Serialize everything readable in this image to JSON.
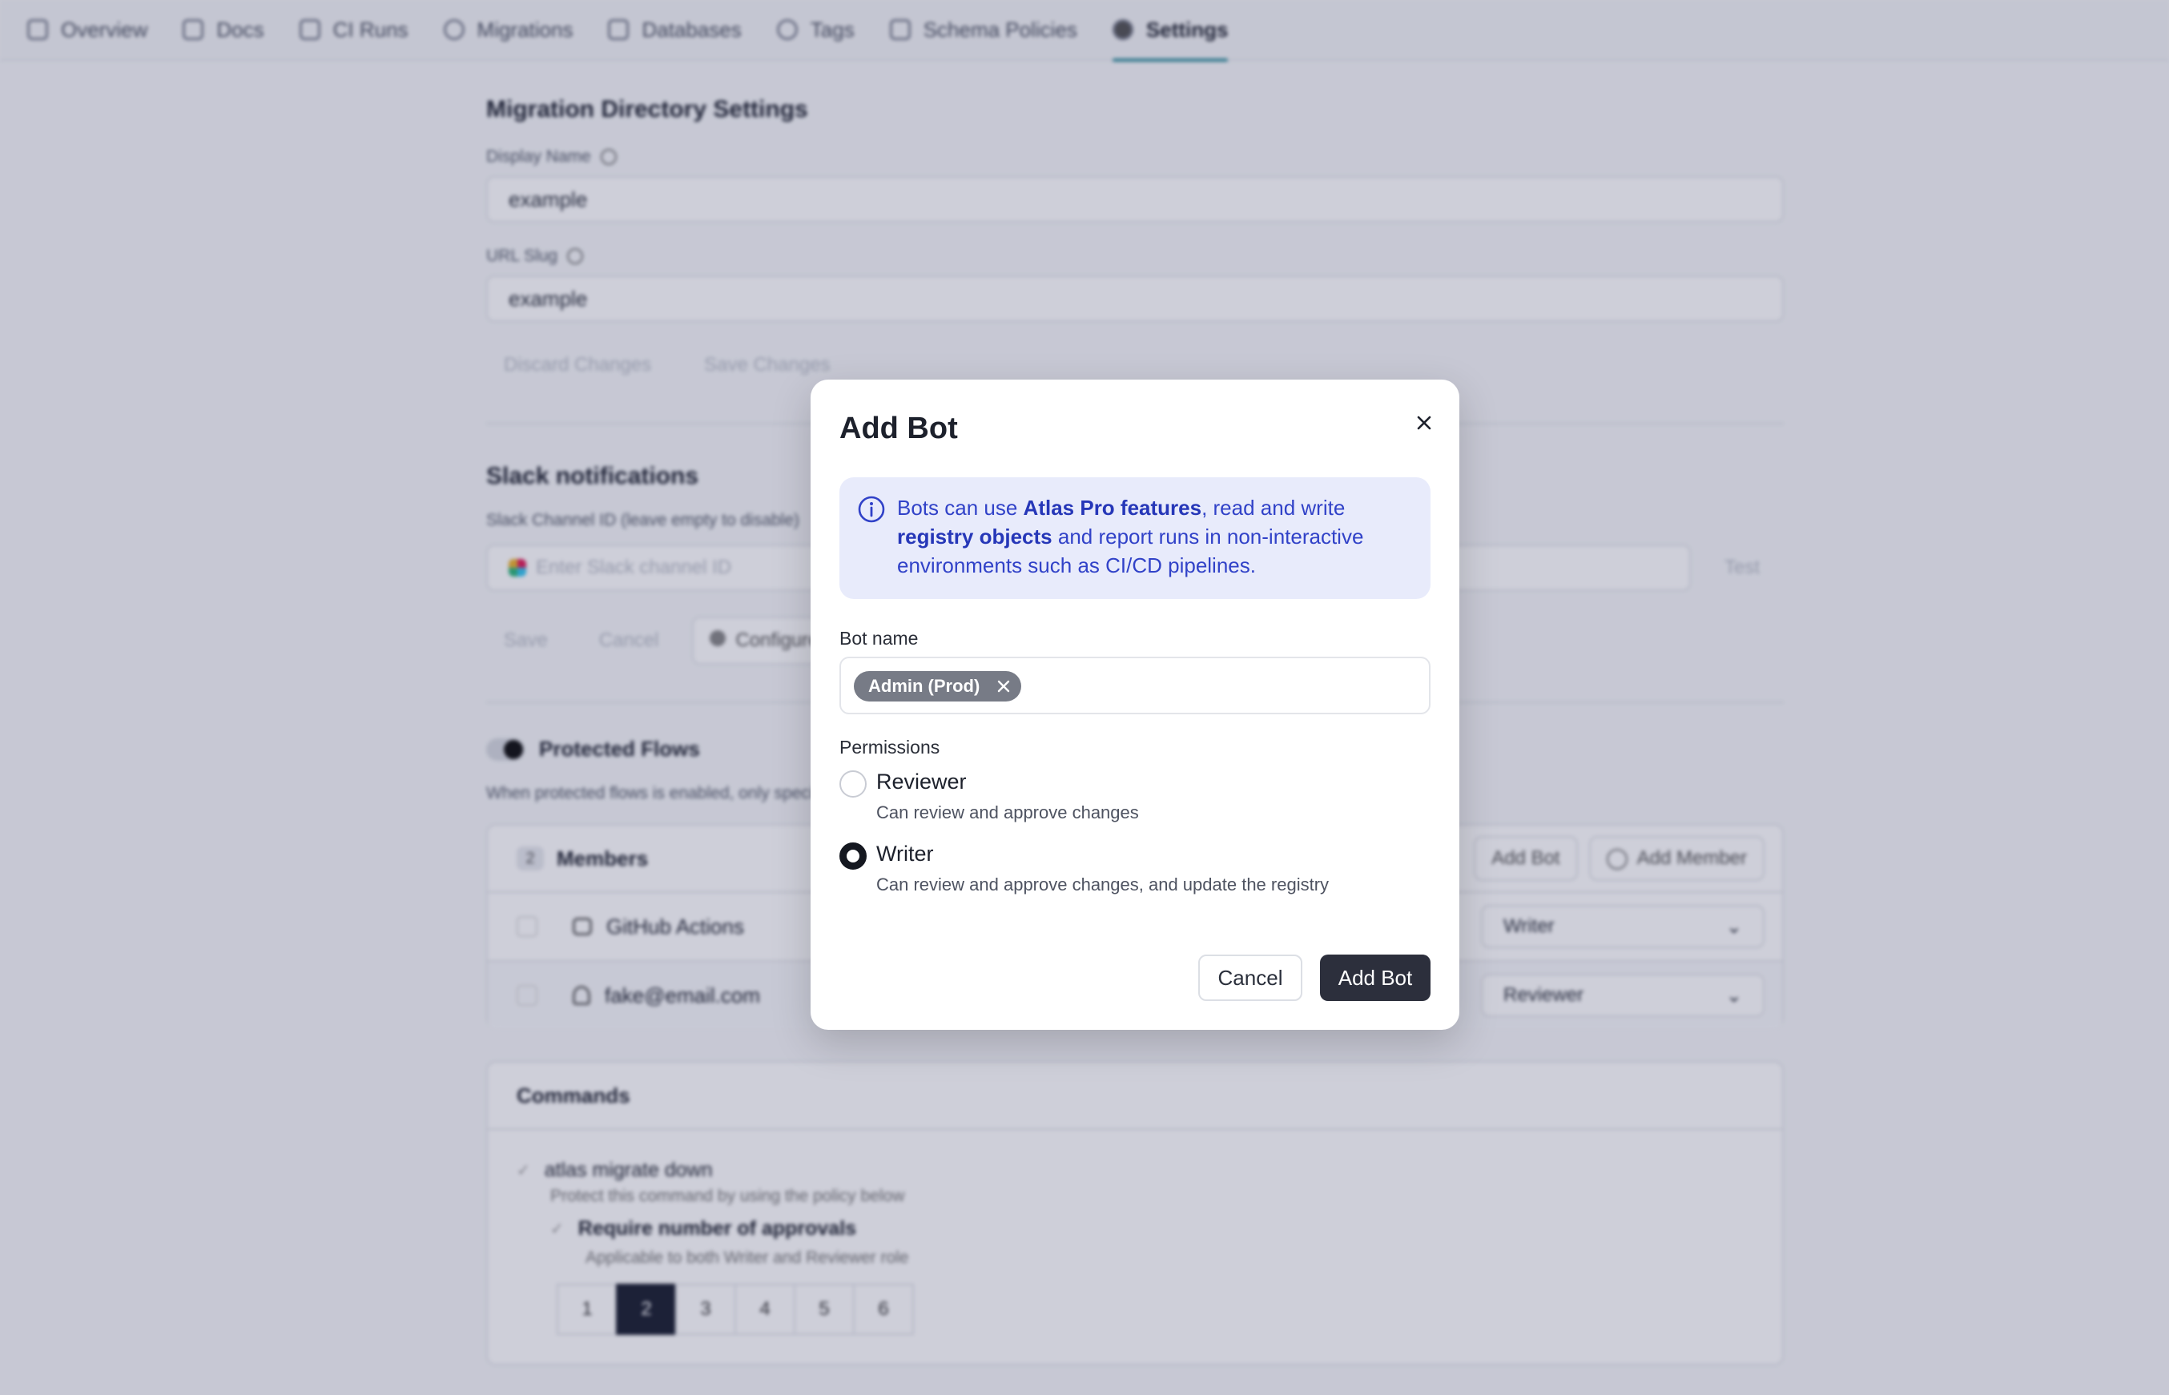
{
  "nav": {
    "tabs": [
      {
        "label": "Overview",
        "icon": "layout-icon"
      },
      {
        "label": "Docs",
        "icon": "book-icon"
      },
      {
        "label": "CI Runs",
        "icon": "ci-icon"
      },
      {
        "label": "Migrations",
        "icon": "migrations-icon"
      },
      {
        "label": "Databases",
        "icon": "database-icon"
      },
      {
        "label": "Tags",
        "icon": "tag-icon"
      },
      {
        "label": "Schema Policies",
        "icon": "policy-icon"
      },
      {
        "label": "Settings",
        "icon": "gear-icon"
      }
    ],
    "active": "Settings"
  },
  "settings": {
    "title": "Migration Directory Settings",
    "display_name_label": "Display Name",
    "display_name_value": "example",
    "url_slug_label": "URL Slug",
    "url_slug_value": "example",
    "discard_label": "Discard Changes",
    "save_label": "Save Changes"
  },
  "slack": {
    "title": "Slack notifications",
    "channel_label": "Slack Channel ID (leave empty to disable)",
    "channel_placeholder": "Enter Slack channel ID",
    "test_label": "Test",
    "save_label": "Save",
    "cancel_label": "Cancel",
    "configure_label": "Configure"
  },
  "protected": {
    "title": "Protected Flows",
    "description": "When protected flows is enabled, only specified members can run commands on this directory",
    "members_count": "2",
    "members_label": "Members",
    "add_bot_label": "Add Bot",
    "add_member_label": "Add Member",
    "members": [
      {
        "name": "GitHub Actions",
        "role": "Writer",
        "icon": "bot-icon"
      },
      {
        "name": "fake@email.com",
        "role": "Reviewer",
        "icon": "user-icon"
      }
    ]
  },
  "commands": {
    "title": "Commands",
    "command": "atlas migrate down",
    "command_desc": "Protect this command by using the policy below",
    "approvals_label": "Require number of approvals",
    "approvals_desc": "Applicable to both Writer and Reviewer role",
    "pages": [
      "1",
      "2",
      "3",
      "4",
      "5",
      "6"
    ],
    "selected_page": "2"
  },
  "modal": {
    "title": "Add Bot",
    "info": {
      "t1": "Bots can use ",
      "b1": "Atlas Pro features",
      "t2": ", read and write ",
      "b2": "registry objects",
      "t3": " and report runs in non-interactive environments such as CI/CD pipelines."
    },
    "bot_name_label": "Bot name",
    "bot_name_tag": "Admin (Prod)",
    "permissions_label": "Permissions",
    "options": [
      {
        "title": "Reviewer",
        "desc": "Can review and approve changes",
        "selected": false
      },
      {
        "title": "Writer",
        "desc": "Can review and approve changes, and update the registry",
        "selected": true
      }
    ],
    "cancel_label": "Cancel",
    "submit_label": "Add Bot"
  },
  "colors": {
    "info_bg": "#e8ebfb",
    "info_text": "#3142c8",
    "primary_button": "#2c2f3c",
    "tag_bg": "#777b86",
    "active_tab_underline": "#2e8b9a"
  }
}
